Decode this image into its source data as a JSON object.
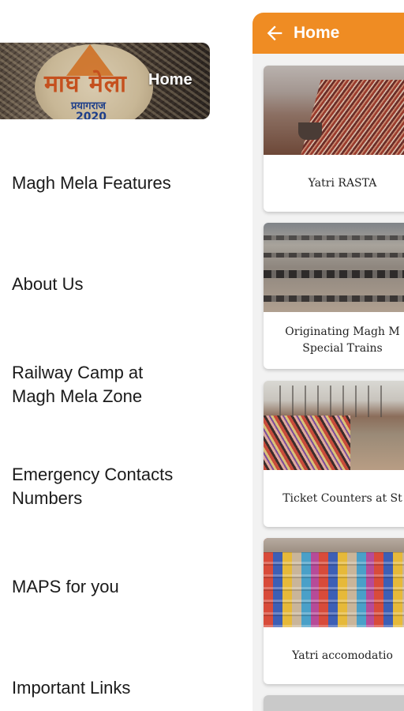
{
  "app_bar": {
    "title": "Home",
    "back_icon": "arrow-left-icon",
    "background_color": "#ef8c23"
  },
  "drawer": {
    "header": {
      "logo_text": "माघ मेला",
      "logo_subtext": "प्रयागराज",
      "logo_year": "2020",
      "label": "Home"
    },
    "items": [
      {
        "label": "Magh Mela Features"
      },
      {
        "label": "About Us"
      },
      {
        "label": "Railway Camp at\nMagh Mela Zone"
      },
      {
        "label": "Emergency Contacts\nNumbers"
      },
      {
        "label": "MAPS for you"
      },
      {
        "label": "Important Links"
      }
    ]
  },
  "cards": [
    {
      "caption": "Yatri RASTA",
      "image": "river-bank-crowd"
    },
    {
      "caption": "Originating Magh M\nSpecial Trains",
      "image": "pontoon-bridges"
    },
    {
      "caption": "Ticket Counters at St",
      "image": "pilgrims-bathing"
    },
    {
      "caption": "Yatri accomodatio",
      "image": "tent-city"
    }
  ]
}
